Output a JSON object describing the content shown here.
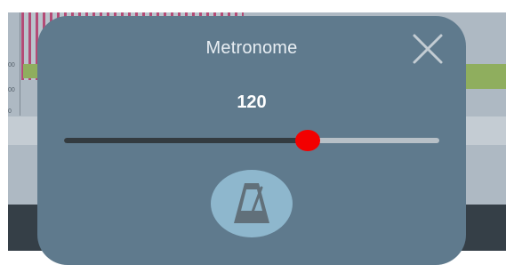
{
  "background": {
    "axis_ticks": [
      "00",
      "00",
      "0"
    ]
  },
  "metronome": {
    "title": "Metronome",
    "bpm_label": "120",
    "slider_fraction": 0.65,
    "icons": {
      "close": "close-icon",
      "metronome": "metronome-icon"
    }
  },
  "colors": {
    "modal_bg": "#5f7a8d",
    "slider_thumb": "#f30000",
    "slider_fill": "#333b40",
    "slider_track": "#b7c0c7",
    "button_bg": "#8eb7cd"
  }
}
